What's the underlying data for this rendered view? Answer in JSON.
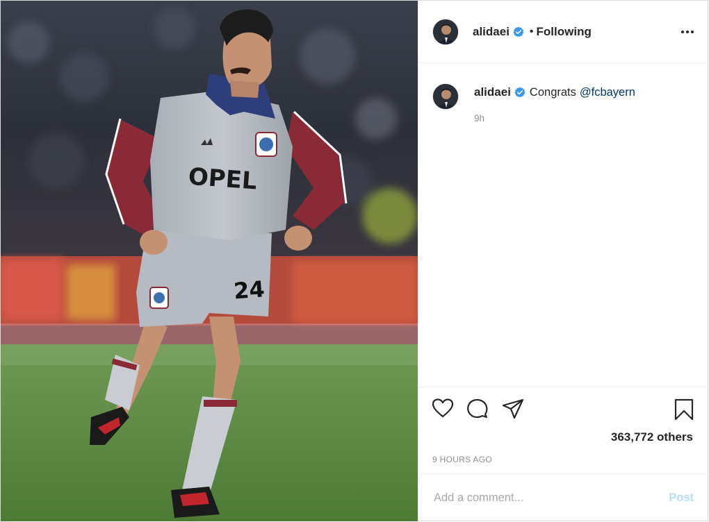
{
  "post": {
    "image_alt": "Footballer in grey and maroon Bayern kit with OPEL sponsor and number 24 on a pitch",
    "kit_sponsor": "OPEL",
    "kit_brand": "adidas",
    "shorts_number": "24"
  },
  "header": {
    "username": "alidaei",
    "separator": "•",
    "follow_status": "Following"
  },
  "caption": {
    "username": "alidaei",
    "text": "Congrats",
    "mention": "@fcbayern",
    "time_ago": "9h"
  },
  "engagement": {
    "likes_text": "363,772 others",
    "posted_ago": "9 HOURS AGO"
  },
  "comment_box": {
    "placeholder": "Add a comment...",
    "post_label": "Post"
  },
  "colors": {
    "verified_badge": "#3897f0",
    "mention": "#00376b",
    "secondary_text": "#8e8e8e",
    "post_button_disabled": "#b2dffc",
    "border": "#dbdbdb"
  },
  "icons": {
    "like": "heart-icon",
    "comment": "speech-bubble-icon",
    "share": "paper-plane-icon",
    "save": "bookmark-icon",
    "more": "ellipsis-icon",
    "verified": "verified-badge-icon"
  }
}
